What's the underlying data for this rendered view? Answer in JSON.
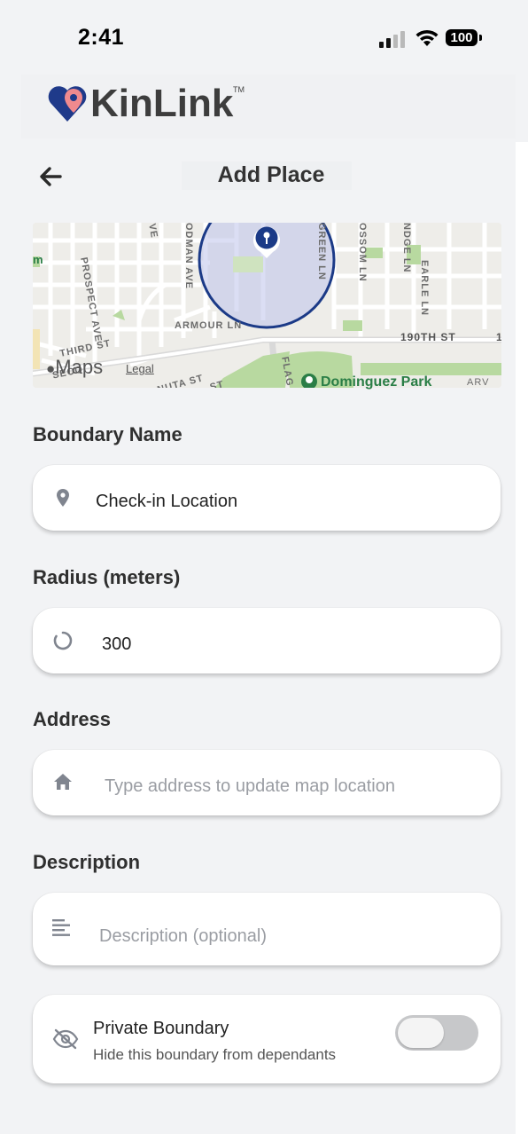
{
  "status_bar": {
    "time": "2:41",
    "battery": "100"
  },
  "app": {
    "name": "KinLink",
    "trademark": "TM"
  },
  "header": {
    "title": "Add Place"
  },
  "map": {
    "attribution": "Maps",
    "legal": "Legal",
    "labels": {
      "prospect_ave": "PROSPECT AVE",
      "armour_ln": "ARMOUR LN",
      "st_190th": "190TH ST",
      "third_st": "THIRD ST",
      "second_st": "SECO",
      "odman_ave": "ODMAN AVE",
      "green_ln": "GREEN LN",
      "ossom_ln": "OSSOM LN",
      "ndge_ln": "NDGE LN",
      "earle_ln": "EARLE LN",
      "nuta_st": "NUTA ST",
      "flag": "FLAG",
      "arv": "ARV",
      "ve": "VE",
      "m": "m",
      "st": "ST",
      "one": "1",
      "park": "Dominguez Park"
    }
  },
  "form": {
    "boundary_name": {
      "label": "Boundary Name",
      "value": "Check-in Location"
    },
    "radius": {
      "label": "Radius (meters)",
      "value": "300"
    },
    "address": {
      "label": "Address",
      "placeholder": "Type address to update map location"
    },
    "description": {
      "label": "Description",
      "placeholder": "Description (optional)"
    },
    "private": {
      "title": "Private Boundary",
      "subtitle": "Hide this boundary from dependants",
      "enabled": false
    }
  },
  "colors": {
    "accent": "#1b3a87",
    "logo_pink": "#f08a8e",
    "park_green": "#2a7e46"
  },
  "icons": [
    "back-arrow-icon",
    "location-pin-icon",
    "radius-circle-icon",
    "home-icon",
    "text-lines-icon",
    "eye-off-icon",
    "apple-logo-icon",
    "wifi-icon",
    "signal-icon"
  ]
}
